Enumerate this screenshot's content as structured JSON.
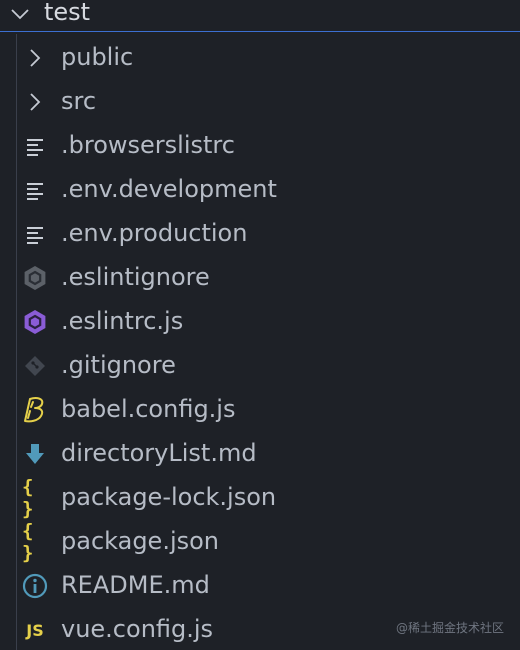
{
  "explorer": {
    "folder_name": "test",
    "items": [
      {
        "label": "public",
        "icon": "chevron-right-icon",
        "type": "folder"
      },
      {
        "label": "src",
        "icon": "chevron-right-icon",
        "type": "folder"
      },
      {
        "label": ".browserslistrc",
        "icon": "text-file-icon",
        "type": "file"
      },
      {
        "label": ".env.development",
        "icon": "text-file-icon",
        "type": "file"
      },
      {
        "label": ".env.production",
        "icon": "text-file-icon",
        "type": "file"
      },
      {
        "label": ".eslintignore",
        "icon": "eslint-ignore-icon",
        "type": "file"
      },
      {
        "label": ".eslintrc.js",
        "icon": "eslint-icon",
        "type": "file"
      },
      {
        "label": ".gitignore",
        "icon": "git-icon",
        "type": "file"
      },
      {
        "label": "babel.config.js",
        "icon": "babel-icon",
        "type": "file"
      },
      {
        "label": "directoryList.md",
        "icon": "markdown-download-icon",
        "type": "file"
      },
      {
        "label": "package-lock.json",
        "icon": "json-icon",
        "type": "file",
        "icon_text": "{ }"
      },
      {
        "label": "package.json",
        "icon": "json-icon",
        "type": "file",
        "icon_text": "{ }"
      },
      {
        "label": "README.md",
        "icon": "info-icon",
        "type": "file"
      },
      {
        "label": "vue.config.js",
        "icon": "javascript-icon",
        "type": "file",
        "icon_text": "JS"
      }
    ]
  },
  "watermark": "@稀土掘金技术社区",
  "colors": {
    "background": "#1e2127",
    "focus_border": "#3c6fd1",
    "label_text": "#b6bcc6",
    "json_yellow": "#e5d04a",
    "eslint_purple": "#8a5cd6",
    "info_blue": "#519aba"
  }
}
